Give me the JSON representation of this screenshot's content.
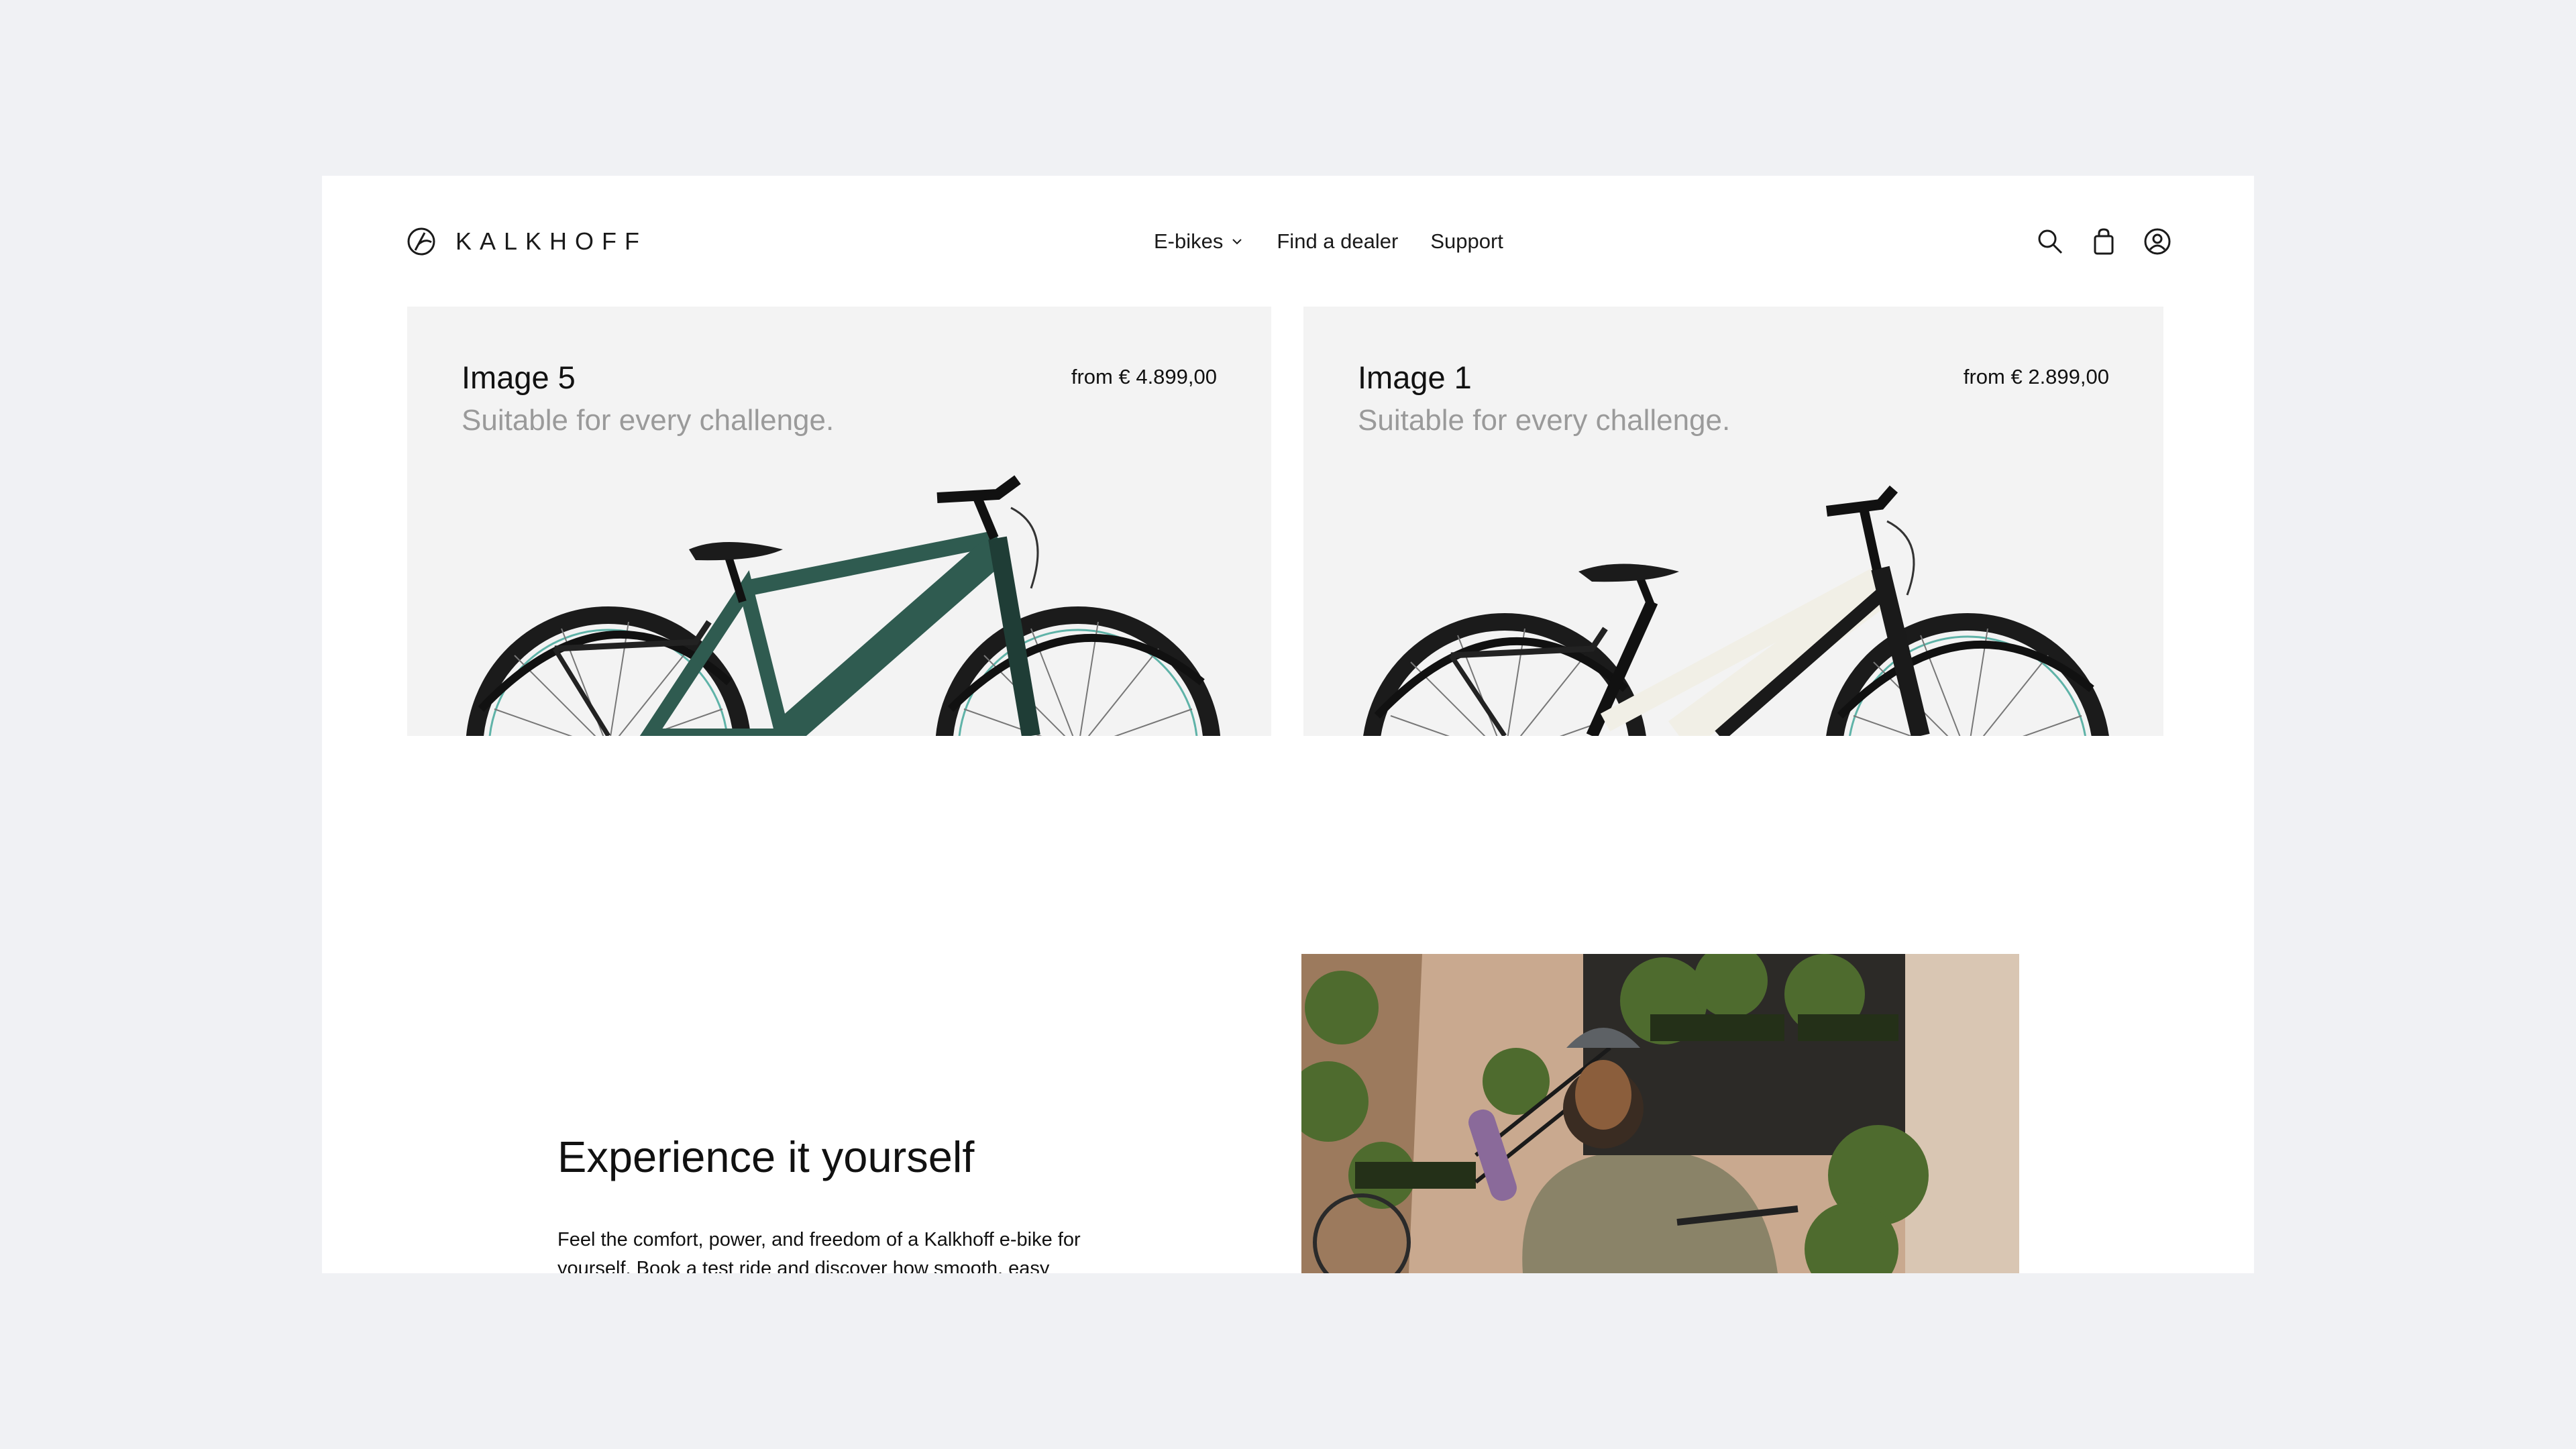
{
  "brand": {
    "name": "KALKHOFF"
  },
  "nav": {
    "items": [
      {
        "label": "E-bikes",
        "has_dropdown": true
      },
      {
        "label": "Find a dealer"
      },
      {
        "label": "Support"
      }
    ]
  },
  "header_icons": [
    "search-icon",
    "cart-icon",
    "account-icon"
  ],
  "cards": [
    {
      "title": "Image 5",
      "subtitle": "Suitable for every challenge.",
      "price": "from € 4.899,00",
      "bike_color": "#2f5b50"
    },
    {
      "title": "Image 1",
      "subtitle": "Suitable for every challenge.",
      "price": "from € 2.899,00",
      "bike_color": "#f1efe6"
    }
  ],
  "experience": {
    "title": "Experience it yourself",
    "body": "Feel the comfort, power, and freedom of a Kalkhoff e-bike for yourself. Book a test ride and discover how smooth, easy"
  },
  "colors": {
    "background": "#f0f1f4",
    "card": "#f3f3f3",
    "muted_text": "#9a9a9a"
  }
}
